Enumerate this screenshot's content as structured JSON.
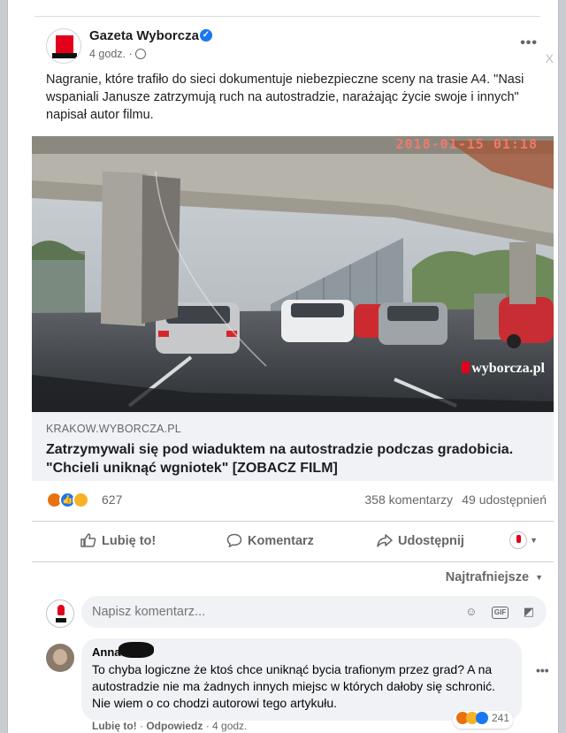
{
  "post": {
    "page_name": "Gazeta Wyborcza",
    "time": "4 godz. ·",
    "text": "Nagranie, które trafiło do sieci dokumentuje niebezpieczne sceny na trasie A4. \"Nasi wspaniali Janusze zatrzymują ruch na autostradzie, narażając życie swoje i innych\" napisał autor filmu.",
    "close": "X",
    "media": {
      "timestamp": "2018-01-15 01:18",
      "watermark": "wyborcza.pl",
      "info_icon": "i"
    },
    "link": {
      "domain": "KRAKOW.WYBORCZA.PL",
      "title": "Zatrzymywali się pod wiaduktem na autostradzie podczas gradobicia. \"Chcieli uniknąć wgniotek\" [ZOBACZ FILM]"
    },
    "stats": {
      "reactions_count": "627",
      "comments": "358 komentarzy",
      "shares": "49 udostępnień"
    },
    "actions": {
      "like": "Lubię to!",
      "comment": "Komentarz",
      "share": "Udostępnij"
    }
  },
  "comments_section": {
    "sort_label": "Najtrafniejsze",
    "input_placeholder": "Napisz komentarz...",
    "comments": [
      {
        "author": "Anna",
        "text": "To chyba logiczne że ktoś chce uniknąć bycia trafionym przez grad? A na autostradzie nie ma żadnych innych miejsc w których dałoby się schronić. Nie wiem o co chodzi autorowi tego artykułu.",
        "like": "Lubię to!",
        "reply": "Odpowiedz",
        "time": "4 godz.",
        "reactions_count": "241"
      }
    ]
  },
  "colors": {
    "facebook_blue": "#1877f2",
    "brand_red": "#e2001a",
    "muted_text": "#65676b"
  },
  "icons": [
    "verified-icon",
    "globe-icon",
    "more-icon",
    "like-icon",
    "comment-icon",
    "share-icon",
    "smiley-icon",
    "gif-icon",
    "sticker-icon",
    "info-icon"
  ]
}
